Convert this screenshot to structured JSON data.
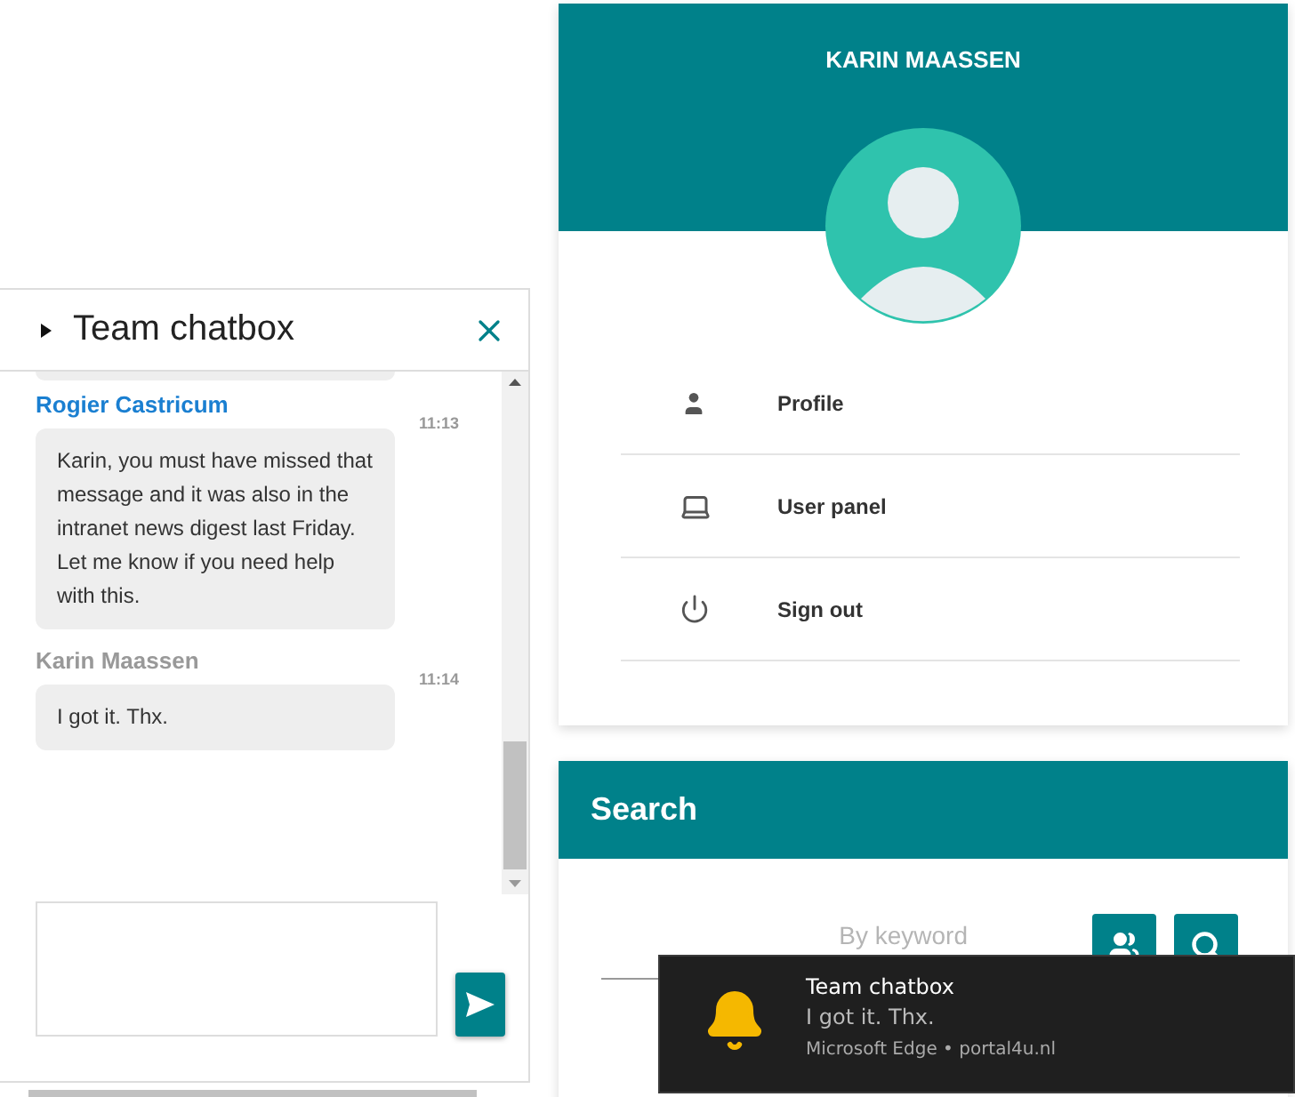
{
  "chat": {
    "title": "Team chatbox",
    "messages": [
      {
        "sender": "Rogier Castricum",
        "own": false,
        "time": "11:13",
        "text": "Karin, you must have missed that message and it was also in the intranet news digest last Friday. Let me know if you need help with this."
      },
      {
        "sender": "Karin Maassen",
        "own": true,
        "time": "11:14",
        "text": "I got it. Thx."
      }
    ]
  },
  "profile": {
    "name": "KARIN MAASSEN",
    "menu": [
      {
        "kind": "person",
        "label": "Profile"
      },
      {
        "kind": "laptop",
        "label": "User panel"
      },
      {
        "kind": "power",
        "label": "Sign out"
      }
    ]
  },
  "search": {
    "title": "Search",
    "placeholder": "By keyword"
  },
  "notification": {
    "title": "Team chatbox",
    "body": "I got it. Thx.",
    "source": "Microsoft Edge • portal4u.nl"
  }
}
